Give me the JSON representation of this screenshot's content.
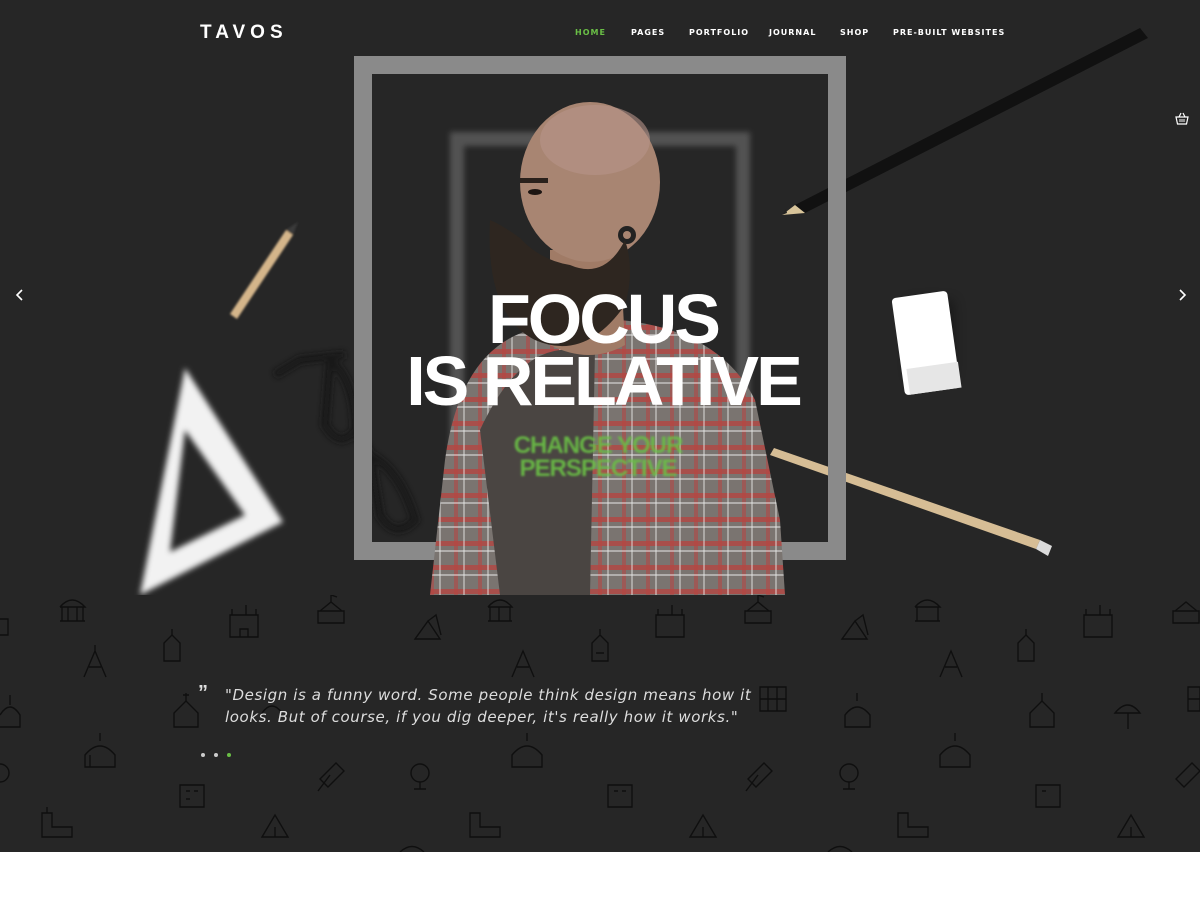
{
  "brand": {
    "logo": "TAVOS"
  },
  "nav": {
    "items": [
      {
        "label": "HOME",
        "active": true
      },
      {
        "label": "PAGES",
        "active": false
      },
      {
        "label": "PORTFOLIO",
        "active": false
      },
      {
        "label": "JOURNAL",
        "active": false
      },
      {
        "label": "SHOP",
        "active": false
      },
      {
        "label": "PRE-BUILT WEBSITES",
        "active": false
      }
    ]
  },
  "icons": {
    "cart": "shopping-basket-icon",
    "prev": "chevron-left-icon",
    "next": "chevron-right-icon",
    "quote": "quote-icon"
  },
  "hero": {
    "headline_line1": "FOCUS",
    "headline_line2": "IS RELATIVE",
    "subline_line1": "CHANGE YOUR",
    "subline_line2": "PERSPECTIVE"
  },
  "testimonial": {
    "quote_mark": "”",
    "text": "\"Design is a funny word. Some people think design means how it looks. But of course, if you dig deeper, it's really how it works.\"",
    "slide_count": 3,
    "active_slide": 3
  },
  "colors": {
    "accent": "#6abf46",
    "background": "#262626",
    "text": "#ffffff"
  }
}
